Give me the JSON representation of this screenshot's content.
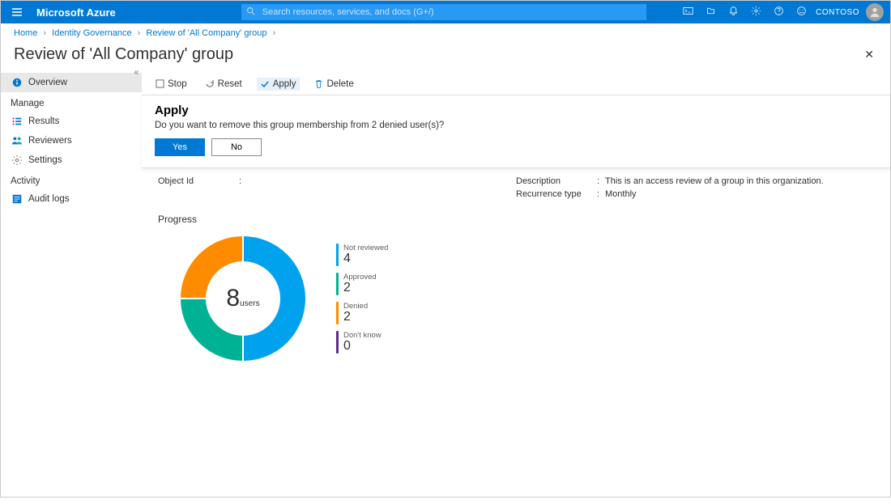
{
  "topbar": {
    "brand": "Microsoft Azure",
    "search_placeholder": "Search resources, services, and docs (G+/)",
    "tenant": "CONTOSO"
  },
  "breadcrumb": {
    "items": [
      "Home",
      "Identity Governance",
      "Review of 'All Company' group"
    ]
  },
  "page_title": "Review of 'All Company' group",
  "sidebar": {
    "overview": "Overview",
    "heading_manage": "Manage",
    "results": "Results",
    "reviewers": "Reviewers",
    "settings": "Settings",
    "heading_activity": "Activity",
    "audit_logs": "Audit logs"
  },
  "toolbar": {
    "stop": "Stop",
    "reset": "Reset",
    "apply": "Apply",
    "delete": "Delete"
  },
  "apply_panel": {
    "title": "Apply",
    "message": "Do you want to remove this group membership from 2 denied user(s)?",
    "yes": "Yes",
    "no": "No"
  },
  "details": {
    "object_id_label": "Object Id",
    "object_id_value": "",
    "description_label": "Description",
    "description_value": "This is an access review of a group in this organization.",
    "recurrence_label": "Recurrence type",
    "recurrence_value": "Monthly"
  },
  "progress": {
    "title": "Progress",
    "center_value": "8",
    "center_unit": "users",
    "legend": {
      "not_reviewed_label": "Not reviewed",
      "not_reviewed_value": "4",
      "approved_label": "Approved",
      "approved_value": "2",
      "denied_label": "Denied",
      "denied_value": "2",
      "dont_know_label": "Don't know",
      "dont_know_value": "0"
    }
  },
  "colors": {
    "not_reviewed": "#00a2ed",
    "approved": "#00b294",
    "denied": "#ff8c00",
    "dont_know": "#5c2d91"
  },
  "chart_data": {
    "type": "pie",
    "title": "Progress",
    "total_label": "users",
    "total": 8,
    "categories": [
      "Not reviewed",
      "Approved",
      "Denied",
      "Don't know"
    ],
    "values": [
      4,
      2,
      2,
      0
    ],
    "colors": [
      "#00a2ed",
      "#00b294",
      "#ff8c00",
      "#5c2d91"
    ]
  }
}
